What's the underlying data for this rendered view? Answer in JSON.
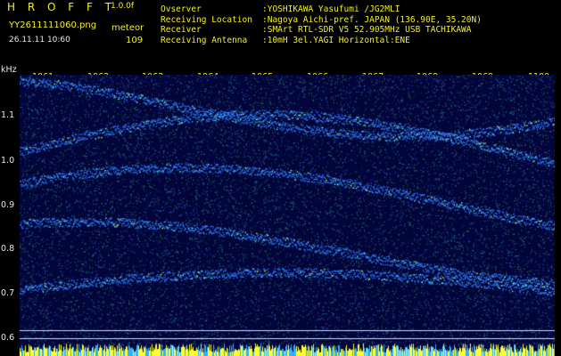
{
  "header": {
    "logo": "H R O F F T",
    "version": "1.0.0f",
    "filename": "YY2611111060.png",
    "datetime": "26.11.11 10:60",
    "mode": "meteor",
    "count": "109"
  },
  "info": [
    {
      "label": "Ovserver",
      "value": ":YOSHIKAWA Yasufumi /JG2MLI"
    },
    {
      "label": "Receiving Location",
      "value": ":Nagoya Aichi-pref. JAPAN (136.90E, 35.20N)"
    },
    {
      "label": "Receiver",
      "value": ":SMArt RTL-SDR V5 52.905MHz USB TACHIKAWA"
    },
    {
      "label": "Receiving Antenna",
      "value": ":10mH 3el.YAGI Horizontal:ENE"
    }
  ],
  "plot": {
    "y_unit": "kHz",
    "x_ticks": [
      "1061",
      "1062",
      "1063",
      "1064",
      "1065",
      "1066",
      "1067",
      "1068",
      "1069",
      "1100"
    ],
    "y_ticks": [
      "1.1",
      "1.0",
      "0.9",
      "0.8",
      "0.7",
      "0.6"
    ],
    "colors": {
      "background": "#02053a",
      "signal": "#2f7dff",
      "strong": "#7fffd0",
      "peak": "#ffff30"
    }
  }
}
